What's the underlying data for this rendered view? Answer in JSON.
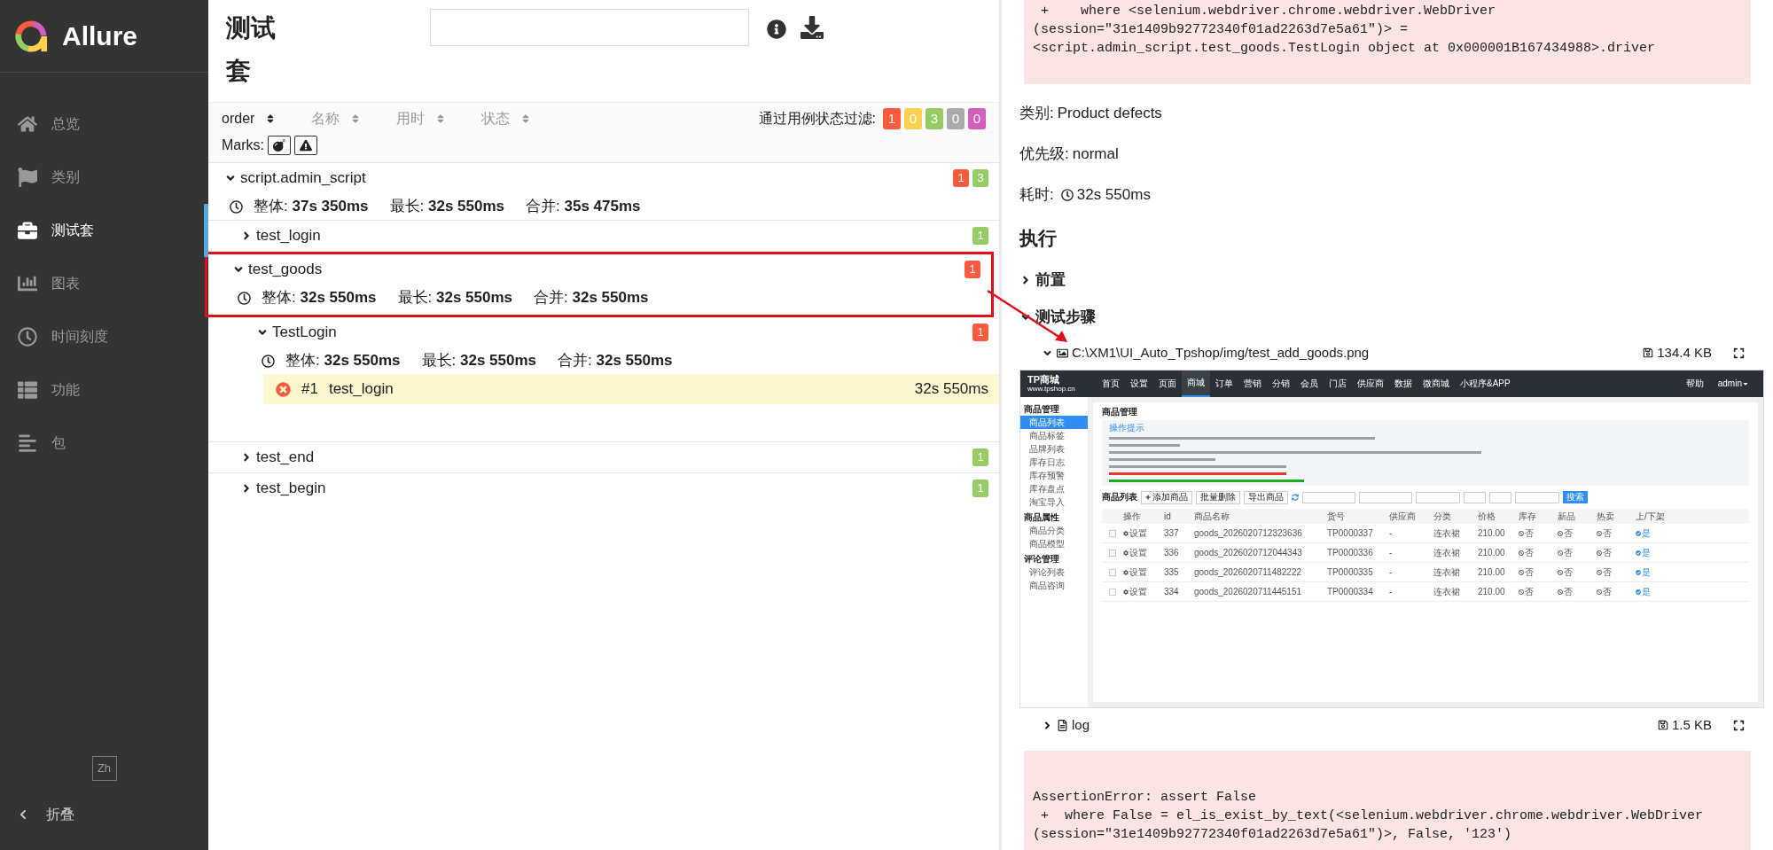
{
  "sidebar": {
    "brand": "Allure",
    "items": [
      {
        "label": "总览",
        "selected": false
      },
      {
        "label": "类别",
        "selected": false
      },
      {
        "label": "测试套",
        "selected": true
      },
      {
        "label": "图表",
        "selected": false
      },
      {
        "label": "时间刻度",
        "selected": false
      },
      {
        "label": "功能",
        "selected": false
      },
      {
        "label": "包",
        "selected": false
      }
    ],
    "language": "Zh",
    "collapse": "折叠"
  },
  "suites": {
    "title": "测试套",
    "sort_columns": [
      {
        "label": "order",
        "selected": true
      },
      {
        "label": "名称",
        "selected": false
      },
      {
        "label": "用时",
        "selected": false
      },
      {
        "label": "状态",
        "selected": false
      }
    ],
    "filter_label": "通过用例状态过滤:",
    "filter_badges": [
      {
        "count": "1",
        "color": "#fd5a3e"
      },
      {
        "count": "0",
        "color": "#ffd050"
      },
      {
        "count": "3",
        "color": "#97cc64"
      },
      {
        "count": "0",
        "color": "#aaaaaa"
      },
      {
        "count": "0",
        "color": "#d35ebe"
      }
    ],
    "marks_label": "Marks:",
    "tree": [
      {
        "name": "script.admin_script",
        "expanded": true,
        "badges": [
          {
            "count": "1",
            "color": "#fd5a3e"
          },
          {
            "count": "3",
            "color": "#97cc64"
          }
        ],
        "stats": [
          {
            "label": "整体:",
            "value": "37s 350ms"
          },
          {
            "label": "最长:",
            "value": "32s 550ms"
          },
          {
            "label": "合并:",
            "value": "35s 475ms"
          }
        ],
        "children": [
          {
            "name": "test_login",
            "expanded": false,
            "badges": [
              {
                "count": "1",
                "color": "#97cc64"
              }
            ]
          },
          {
            "name": "test_goods",
            "expanded": true,
            "highlighted": true,
            "badges": [
              {
                "count": "1",
                "color": "#fd5a3e"
              }
            ],
            "stats": [
              {
                "label": "整体:",
                "value": "32s 550ms"
              },
              {
                "label": "最长:",
                "value": "32s 550ms"
              },
              {
                "label": "合并:",
                "value": "32s 550ms"
              }
            ],
            "children": [
              {
                "name": "TestLogin",
                "expanded": true,
                "badges": [
                  {
                    "count": "1",
                    "color": "#fd5a3e"
                  }
                ],
                "stats": [
                  {
                    "label": "整体:",
                    "value": "32s 550ms"
                  },
                  {
                    "label": "最长:",
                    "value": "32s 550ms"
                  },
                  {
                    "label": "合并:",
                    "value": "32s 550ms"
                  }
                ],
                "tests": [
                  {
                    "index": "#1",
                    "name": "test_login",
                    "duration": "32s 550ms",
                    "selected": true
                  }
                ]
              }
            ]
          },
          {
            "name": "test_end",
            "expanded": false,
            "badges": [
              {
                "count": "1",
                "color": "#97cc64"
              }
            ]
          },
          {
            "name": "test_begin",
            "expanded": false,
            "badges": [
              {
                "count": "1",
                "color": "#97cc64"
              }
            ]
          }
        ]
      }
    ]
  },
  "details": {
    "error_top": [
      " +    where <selenium.webdriver.chrome.webdriver.WebDriver",
      "(session=\"31e1409b92772340f01ad2263d7e5a61\")> =",
      "<script.admin_script.test_goods.TestLogin object at 0x000001B167434988>.driver"
    ],
    "meta": [
      {
        "kind": "text",
        "label": "类别:",
        "value": "Product defects"
      },
      {
        "kind": "text",
        "label": "优先级:",
        "value": "normal"
      },
      {
        "kind": "duration",
        "label": "耗时:",
        "value": "32s 550ms"
      }
    ],
    "heading": "执行",
    "sections": [
      {
        "title": "前置",
        "expanded": false
      },
      {
        "title": "测试步骤",
        "expanded": true
      }
    ],
    "attachments": [
      {
        "kind": "image",
        "name": "C:\\XM1\\UI_Auto_Tpshop/img/test_add_goods.png",
        "size": "134.4 KB",
        "expanded": true
      },
      {
        "kind": "text",
        "name": "log",
        "size": "1.5 KB",
        "expanded": false
      }
    ],
    "error_bottom": [
      "AssertionError: assert False",
      " +  where False = el_is_exist_by_text(<selenium.webdriver.chrome.webdriver.WebDriver",
      "(session=\"31e1409b92772340f01ad2263d7e5a61\")>, False, '123')"
    ],
    "arrow": true
  },
  "screenshot": {
    "brand": "TP商城",
    "site": "www.tpshop.cn",
    "nav": [
      {
        "label": "首页",
        "selected": false
      },
      {
        "label": "设置",
        "selected": false
      },
      {
        "label": "页面",
        "selected": false
      },
      {
        "label": "商城",
        "selected": true
      },
      {
        "label": "订单",
        "selected": false
      },
      {
        "label": "营销",
        "selected": false
      },
      {
        "label": "分销",
        "selected": false
      },
      {
        "label": "会员",
        "selected": false
      },
      {
        "label": "门店",
        "selected": false
      },
      {
        "label": "供应商",
        "selected": false
      },
      {
        "label": "数据",
        "selected": false
      },
      {
        "label": "微商城",
        "selected": false
      },
      {
        "label": "小程序&APP",
        "selected": false
      }
    ],
    "help": "帮助",
    "user": "admin",
    "side_groups": [
      {
        "title": "商品管理",
        "items": [
          {
            "label": "商品列表",
            "selected": true
          },
          {
            "label": "商品标签",
            "selected": false
          },
          {
            "label": "品牌列表",
            "selected": false
          },
          {
            "label": "库存日志",
            "selected": false
          },
          {
            "label": "库存预警",
            "selected": false
          },
          {
            "label": "库存盘点",
            "selected": false
          },
          {
            "label": "淘宝导入",
            "selected": false
          }
        ]
      },
      {
        "title": "商品属性",
        "items": [
          {
            "label": "商品分类",
            "selected": false
          },
          {
            "label": "商品模型",
            "selected": false
          }
        ]
      },
      {
        "title": "评论管理",
        "items": [
          {
            "label": "评论列表",
            "selected": false
          },
          {
            "label": "商品咨询",
            "selected": false
          }
        ]
      }
    ],
    "page_title": "商品管理",
    "tips_title": "操作提示",
    "list_title": "商品列表",
    "toolbar_buttons": [
      "添加商品",
      "批量删除",
      "导出商品"
    ],
    "search_button": "搜索",
    "columns": [
      "操作",
      "id",
      "商品名称",
      "货号",
      "供应商",
      "分类",
      "价格",
      "库存",
      "新品",
      "热卖",
      "上/下架"
    ],
    "rows": [
      {
        "checked": false,
        "action": "设置",
        "id": "337",
        "name": "goods_2026020712323636",
        "sku": "TP0000337",
        "supplier": "-",
        "category": "连衣裙",
        "price": "210.00",
        "flags": [
          "否",
          "否",
          "否"
        ],
        "on_sale": "是"
      },
      {
        "checked": false,
        "action": "设置",
        "id": "336",
        "name": "goods_2026020712044343",
        "sku": "TP0000336",
        "supplier": "-",
        "category": "连衣裙",
        "price": "210.00",
        "flags": [
          "否",
          "否",
          "否"
        ],
        "on_sale": "是"
      },
      {
        "checked": false,
        "action": "设置",
        "id": "335",
        "name": "goods_2026020711482222",
        "sku": "TP0000335",
        "supplier": "-",
        "category": "连衣裙",
        "price": "210.00",
        "flags": [
          "否",
          "否",
          "否"
        ],
        "on_sale": "是"
      },
      {
        "checked": false,
        "action": "设置",
        "id": "334",
        "name": "goods_2026020711445151",
        "sku": "TP0000334",
        "supplier": "-",
        "category": "连衣裙",
        "price": "210.00",
        "flags": [
          "否",
          "否",
          "否"
        ],
        "on_sale": "是"
      }
    ]
  }
}
